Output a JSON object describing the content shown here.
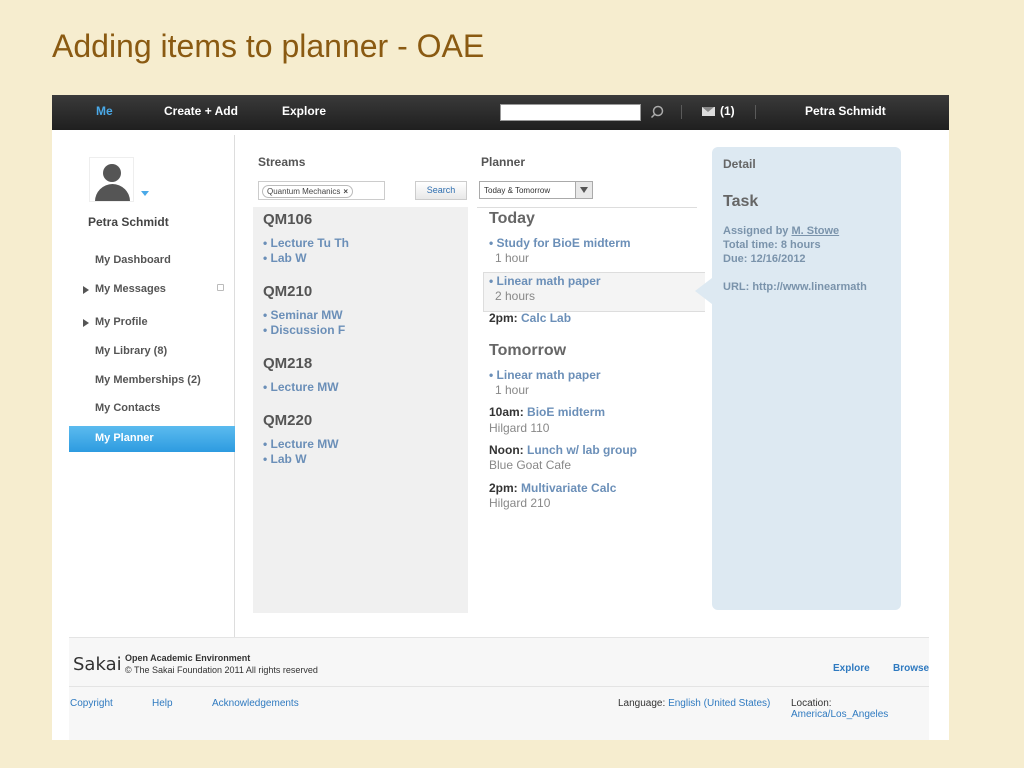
{
  "slide": {
    "title": "Adding items to planner - OAE"
  },
  "topbar": {
    "nav": [
      "Me",
      "Create + Add",
      "Explore"
    ],
    "mail_count": "(1)",
    "user_name": "Petra Schmidt"
  },
  "leftnav": {
    "profile_name": "Petra Schmidt",
    "items": [
      "My Dashboard",
      "My Messages",
      "My Profile",
      "My Library (8)",
      "My Memberships (2)",
      "My Contacts",
      "My Planner"
    ]
  },
  "streams": {
    "heading": "Streams",
    "tag": "Quantum Mechanics",
    "tag_remove": "×",
    "search_label": "Search",
    "courses": [
      {
        "code": "QM106",
        "items": [
          "• Lecture Tu Th",
          "• Lab W"
        ]
      },
      {
        "code": "QM210",
        "items": [
          "• Seminar MW",
          "• Discussion F"
        ]
      },
      {
        "code": "QM218",
        "items": [
          "• Lecture MW"
        ]
      },
      {
        "code": "QM220",
        "items": [
          "• Lecture MW",
          "• Lab W"
        ]
      }
    ]
  },
  "planner": {
    "heading": "Planner",
    "select_value": "Today & Tomorrow",
    "today": {
      "heading": "Today",
      "item1": "• Study for BioE midterm",
      "item1_sub": "1 hour",
      "item2": "• Linear math paper",
      "item2_sub": "2 hours",
      "item3_time": "2pm:",
      "item3": "Calc Lab"
    },
    "tomorrow": {
      "heading": "Tomorrow",
      "item1": "• Linear math paper",
      "item1_sub": "1 hour",
      "item2_time": "10am:",
      "item2": "BioE midterm",
      "item2_loc": "Hilgard 110",
      "item3_time": "Noon:",
      "item3": "Lunch w/ lab group",
      "item3_loc": "Blue Goat Cafe",
      "item4_time": "2pm:",
      "item4": "Multivariate Calc",
      "item4_loc": "Hilgard 210"
    }
  },
  "detail": {
    "heading": "Detail",
    "title": "Task",
    "assigned_prefix": "Assigned by",
    "assigned_by": "M. Stowe",
    "total_time": "Total time: 8 hours",
    "due": "Due: 12/16/2012",
    "url": "URL: http://www.linearmath"
  },
  "footer": {
    "logo": "Sakai",
    "org_name": "Open Academic Environment",
    "copyright": "© The Sakai Foundation 2011 All rights reserved",
    "explore": "Explore",
    "browse": "Browse",
    "links": [
      "Copyright",
      "Help",
      "Acknowledgements"
    ],
    "language_label": "Language:",
    "language": "English (United States)",
    "location_label": "Location:",
    "location": "America/Los_Angeles"
  },
  "colors": {
    "accent": "#2d9be0",
    "link": "#6b8fb8",
    "slide_bg": "#f6edcf",
    "title": "#8a5a12",
    "detail_bg": "#dde9f2"
  }
}
